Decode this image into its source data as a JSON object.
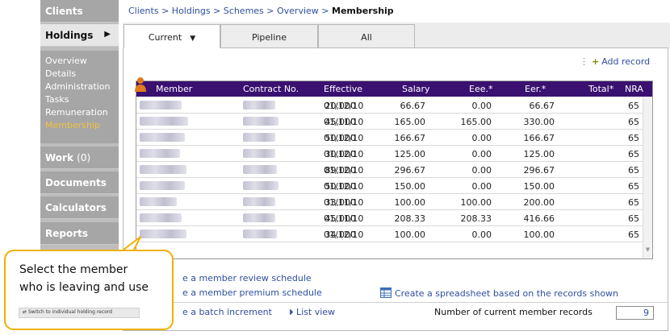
{
  "nav": {
    "clients": "Clients",
    "holdings": "Holdings",
    "holdings_arrow": "▶",
    "work": "Work",
    "work_count": "(0)",
    "documents": "Documents",
    "calculators": "Calculators",
    "reports": "Reports",
    "subitems": [
      "Overview",
      "Details",
      "Administration",
      "Tasks",
      "Remuneration",
      "Membership"
    ]
  },
  "breadcrumb": {
    "items": [
      "Clients",
      "Holdings",
      "Schemes",
      "Overview"
    ],
    "separator": ">",
    "current": "Membership"
  },
  "tabs": {
    "current": "Current",
    "current_caret": "▼",
    "pipeline": "Pipeline",
    "all": "All"
  },
  "toolbar": {
    "add_record": "Add record"
  },
  "table": {
    "headers": [
      "Member",
      "Contract No.",
      "Effective",
      "Salary",
      "Eee.*",
      "Eer.*",
      "Total*",
      "NRA"
    ],
    "rows": [
      [
        "01/12/10",
        "20,000",
        "66.67",
        "0.00",
        "66.67",
        "65"
      ],
      [
        "01/11/10",
        "45,000",
        "165.00",
        "165.00",
        "330.00",
        "65"
      ],
      [
        "01/12/10",
        "50,000",
        "166.67",
        "0.00",
        "166.67",
        "65"
      ],
      [
        "01/12/10",
        "30,000",
        "125.00",
        "0.00",
        "125.00",
        "65"
      ],
      [
        "01/12/10",
        "89,000",
        "296.67",
        "0.00",
        "296.67",
        "65"
      ],
      [
        "01/12/10",
        "50,000",
        "150.00",
        "0.00",
        "150.00",
        "65"
      ],
      [
        "01/11/10",
        "33,000",
        "100.00",
        "100.00",
        "200.00",
        "65"
      ],
      [
        "01/11/10",
        "45,000",
        "208.33",
        "208.33",
        "416.66",
        "65"
      ],
      [
        "01/12/10",
        "34,000",
        "100.00",
        "0.00",
        "100.00",
        "65"
      ]
    ]
  },
  "links": {
    "review_schedule": "e a member review schedule",
    "premium_schedule": "e a member premium schedule",
    "batch_increment": "e a batch increment",
    "list_view": "List view",
    "spreadsheet": "Create a spreadsheet based on the records shown"
  },
  "footer": {
    "count_label": "Number of current member records",
    "count_value": "9"
  },
  "callout": {
    "line1": "Select the member",
    "line2": "who is leaving and use",
    "button": "Switch to individual holding record"
  },
  "colors": {
    "header_bg": "#3a1170",
    "link": "#2e4f9e",
    "callout_border": "#f0b000",
    "nav_gray": "#a6a6a6"
  }
}
